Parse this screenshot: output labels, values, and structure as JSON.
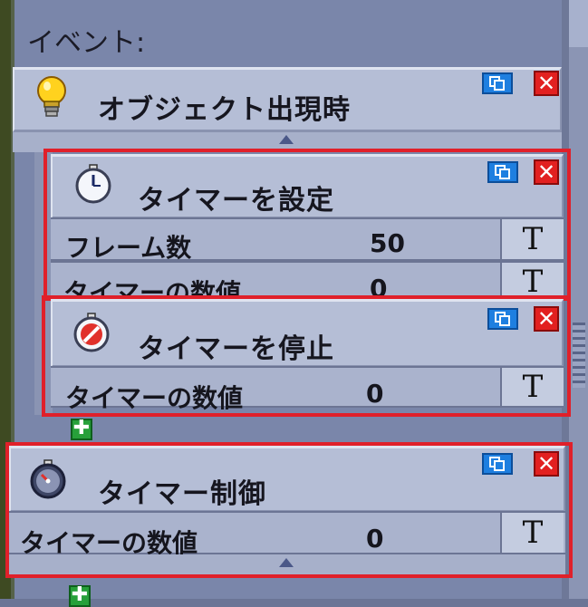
{
  "section_label": "イベント:",
  "event": {
    "title": "オブジェクト出現時",
    "icon": "lightbulb-icon"
  },
  "actions": [
    {
      "title": "タイマーを設定",
      "icon": "stopwatch-icon",
      "rows": [
        {
          "label": "フレーム数",
          "value": "50"
        },
        {
          "label": "タイマーの数値",
          "value": "0"
        }
      ]
    },
    {
      "title": "タイマーを停止",
      "icon": "stopwatch-stop-icon",
      "rows": [
        {
          "label": "タイマーの数値",
          "value": "0"
        }
      ]
    },
    {
      "title": "タイマー制御",
      "icon": "stopwatch-control-icon",
      "rows": [
        {
          "label": "タイマーの数値",
          "value": "0"
        }
      ]
    }
  ],
  "buttons": {
    "type_glyph": "T",
    "delete_glyph": "✕",
    "add_glyph": "✚"
  },
  "colors": {
    "highlight": "#e0202a",
    "copy": "#1e7fe0",
    "delete": "#e22020",
    "add": "#27a03a"
  }
}
